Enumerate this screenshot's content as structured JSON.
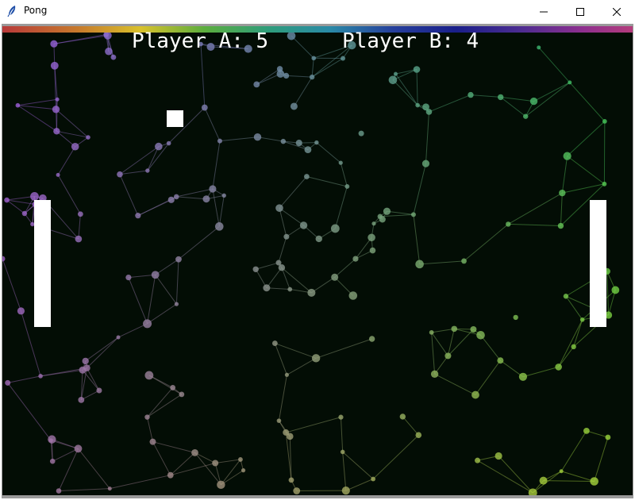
{
  "window": {
    "title": "Pong",
    "icon": "feather-icon",
    "controls": [
      "minimize-icon",
      "maximize-icon",
      "close-icon"
    ]
  },
  "scoreboard": {
    "player_a_label": "Player A: 5",
    "player_b_label": "Player B: 4",
    "player_a_score": 5,
    "player_b_score": 4
  },
  "colors": {
    "background": "#030d05",
    "paddle": "#ffffff",
    "ball": "#ffffff",
    "score_text": "#ffffff"
  }
}
